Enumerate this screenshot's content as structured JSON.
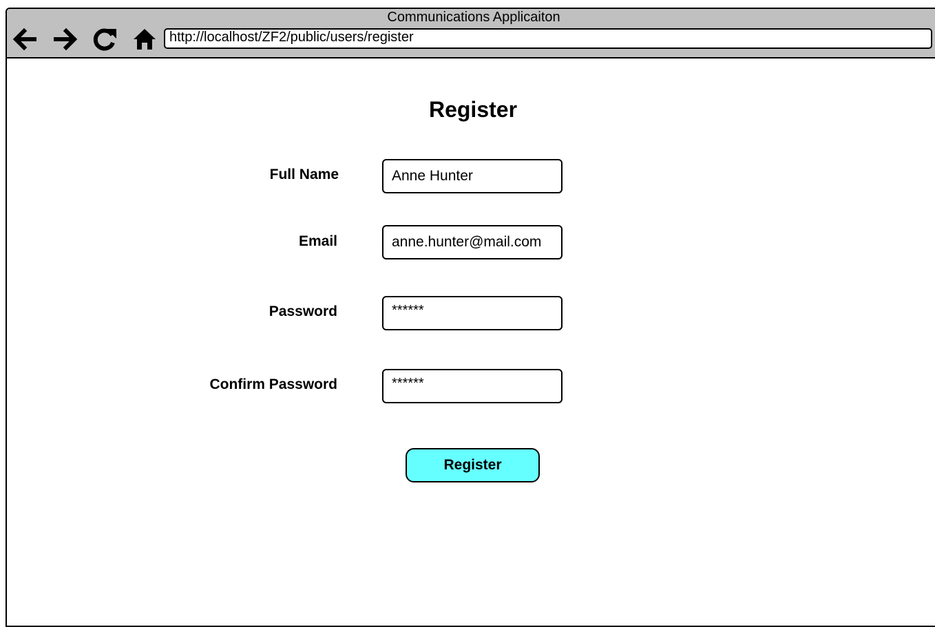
{
  "window": {
    "title": "Communications Applicaiton"
  },
  "toolbar": {
    "buttons": [
      {
        "name": "back",
        "icon": "arrow-left-icon"
      },
      {
        "name": "forward",
        "icon": "arrow-right-icon"
      },
      {
        "name": "reload",
        "icon": "reload-icon"
      },
      {
        "name": "home",
        "icon": "home-icon"
      }
    ],
    "address": "http://localhost/ZF2/public/users/register"
  },
  "form": {
    "title": "Register",
    "fields": [
      {
        "label": "Full Name",
        "value": "Anne Hunter",
        "type": "text"
      },
      {
        "label": "Email",
        "value": "anne.hunter@mail.com",
        "type": "text"
      },
      {
        "label": "Password",
        "value": "******",
        "type": "text"
      },
      {
        "label": "Confirm Password",
        "value": "******",
        "type": "text"
      }
    ],
    "submit_label": "Register"
  },
  "colors": {
    "chrome": "#c0c0c0",
    "button": "#66ffff"
  }
}
